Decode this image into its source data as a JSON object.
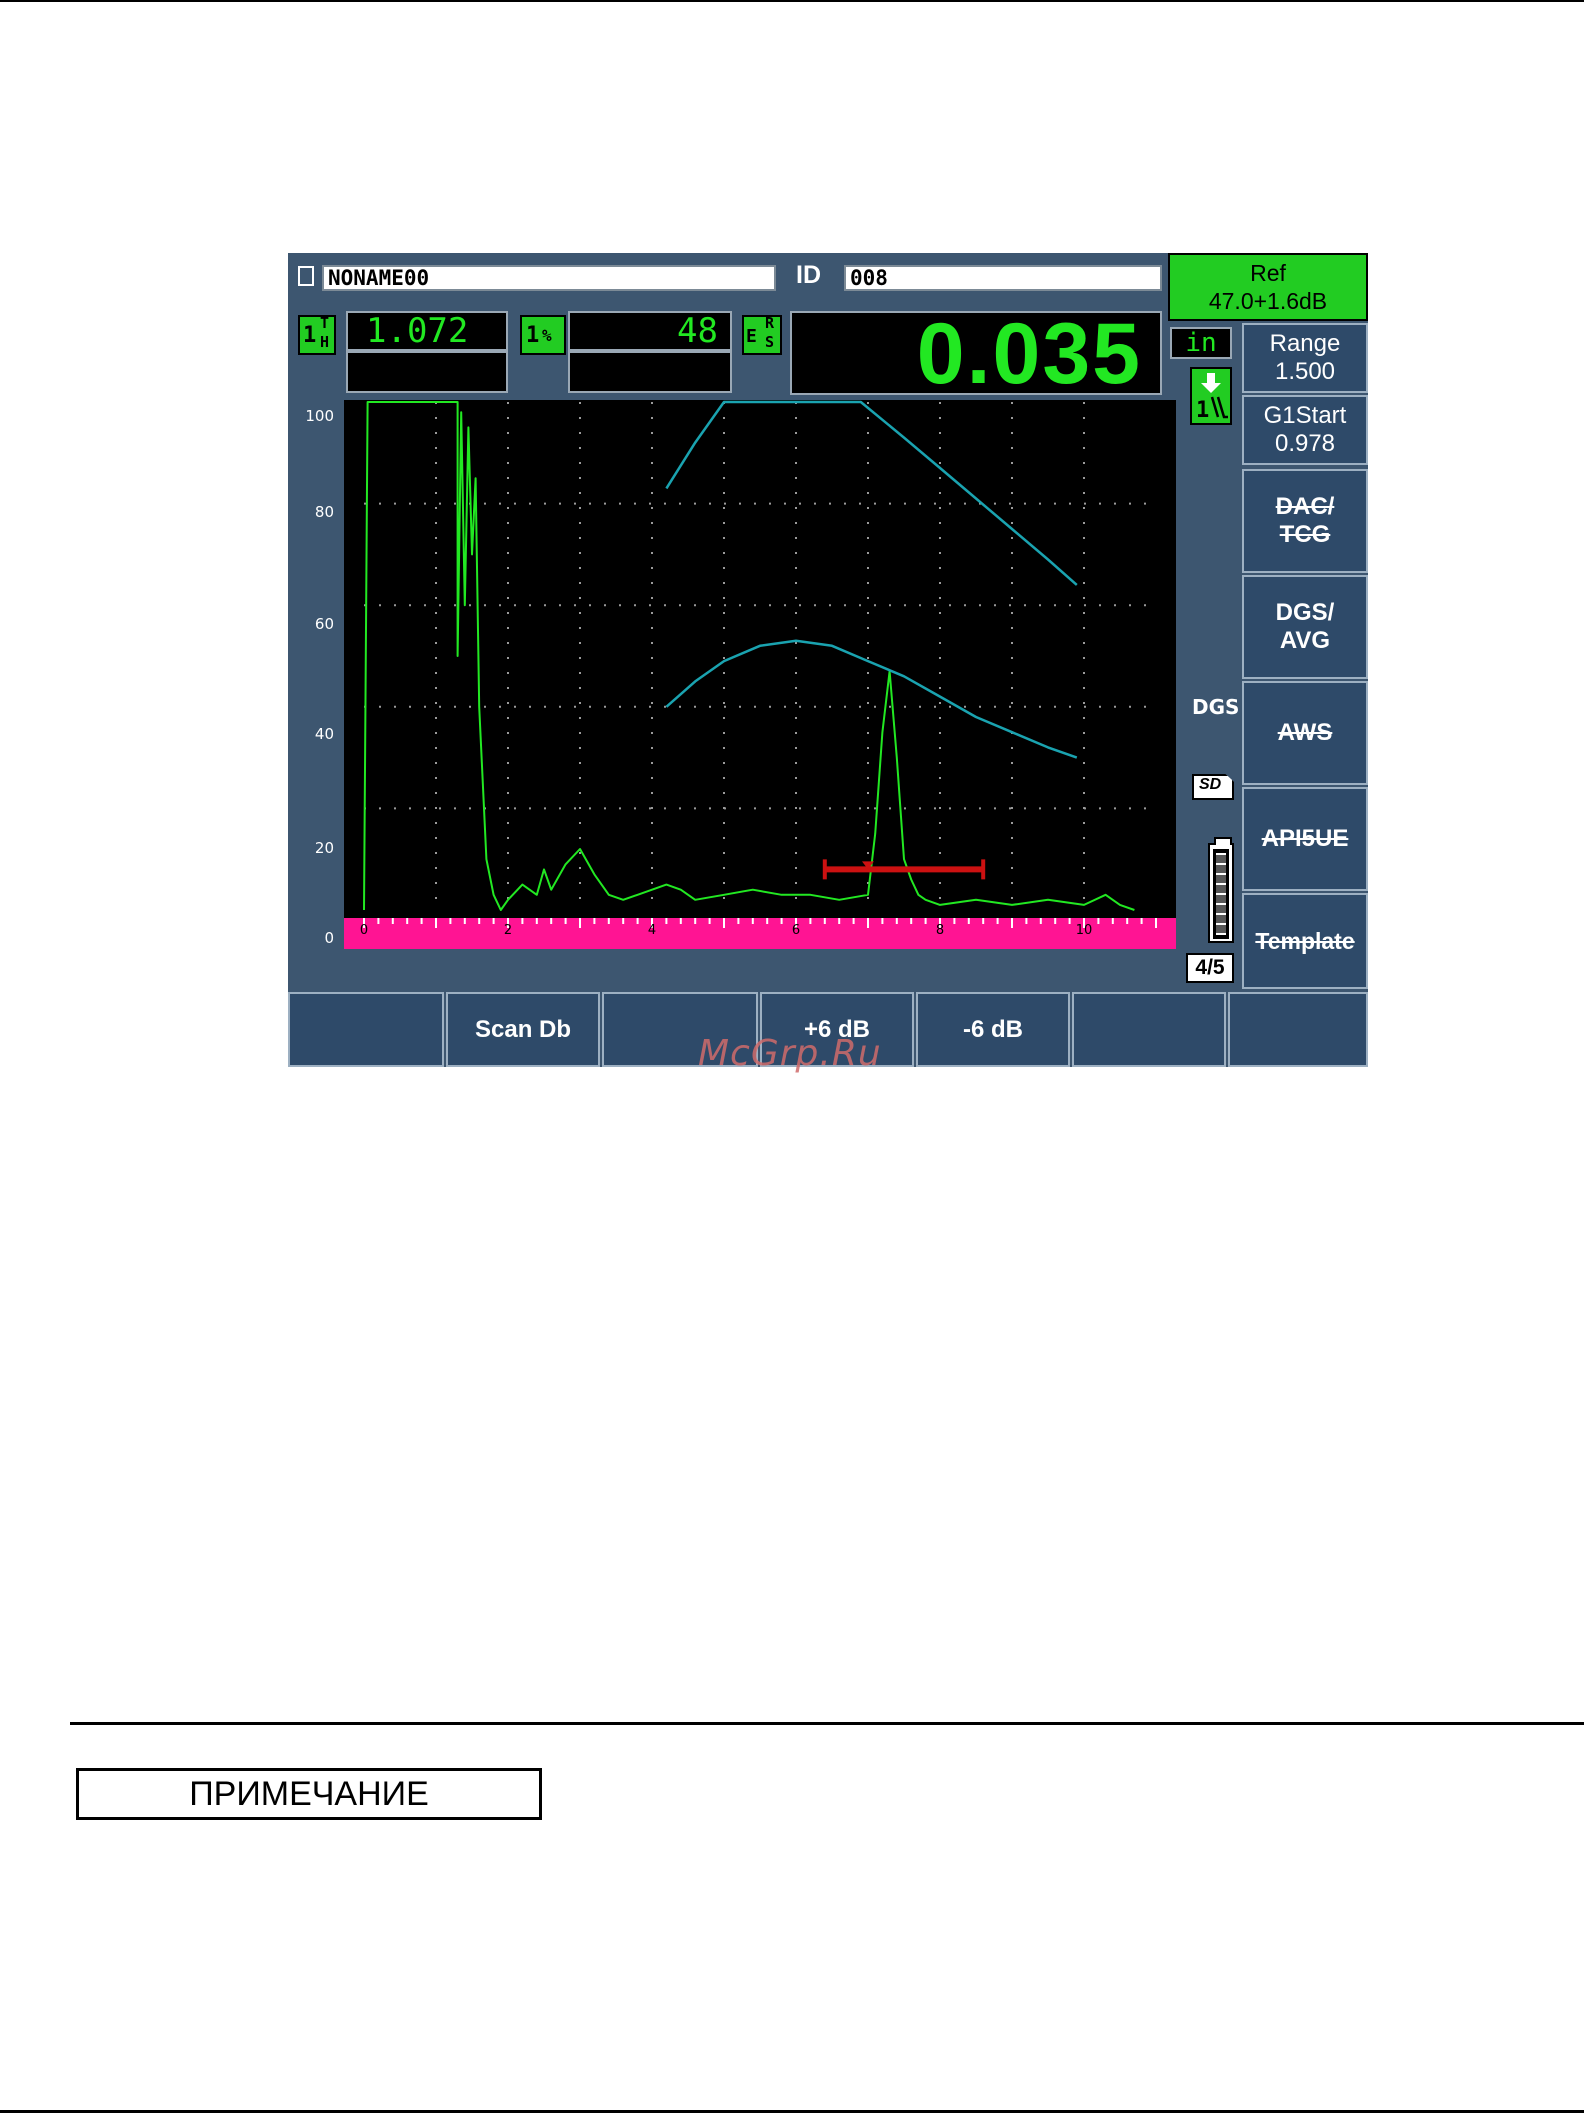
{
  "device": {
    "file_name": "NONAME00",
    "id_label": "ID",
    "id_value": "008",
    "ref": {
      "label": "Ref",
      "value": "47.0+1.6dB"
    },
    "readout_thickness": {
      "gate": "1",
      "sup": "T",
      "sub": "H",
      "value": "1.072"
    },
    "readout_amplitude": {
      "gate": "1",
      "unit": "%",
      "value": "48"
    },
    "readout_main": {
      "sup": "R",
      "sub": "S",
      "prefix": "E",
      "value": "0.035"
    },
    "unit": "in",
    "indicator_gate": "1",
    "dgs_label": "DGS",
    "sd_label": "SD",
    "page_indicator": "4/5",
    "side_buttons": {
      "range": {
        "label": "Range",
        "value": "1.500"
      },
      "g1start": {
        "label": "G1Start",
        "value": "0.978"
      },
      "dac_tcg": "DAC/ TCG",
      "dgs_avg": "DGS/ AVG",
      "aws": "AWS",
      "api5ue": "API5UE",
      "template": "Template"
    },
    "bottom_buttons": [
      "",
      "Scan Db",
      "",
      "+6 dB",
      "-6 dB",
      "",
      ""
    ],
    "colors": {
      "trace": "#22e822",
      "curves": "#1aa3b0",
      "gate": "#cc1111",
      "ruler": "#ff1493",
      "ref_bg": "#22cc22"
    }
  },
  "chart_data": {
    "type": "line",
    "y_ticks": [
      "100",
      "80",
      "60",
      "40",
      "20",
      "0"
    ],
    "x_ticks": [
      "0",
      "2",
      "4",
      "6",
      "8",
      "10"
    ],
    "xlim": [
      0,
      11
    ],
    "ylim": [
      0,
      100
    ],
    "series": [
      {
        "role": "a-scan",
        "x": [
          0,
          0.05,
          0.1,
          1.3,
          1.3,
          1.35,
          1.4,
          1.45,
          1.5,
          1.55,
          1.6,
          1.7,
          1.8,
          1.9,
          2.0,
          2.2,
          2.4,
          2.5,
          2.6,
          2.8,
          3.0,
          3.2,
          3.4,
          3.6,
          3.8,
          4.0,
          4.2,
          4.4,
          4.6,
          5.0,
          5.4,
          5.8,
          6.2,
          6.6,
          7.0,
          7.1,
          7.2,
          7.3,
          7.4,
          7.45,
          7.5,
          7.6,
          7.7,
          7.8,
          8.0,
          8.5,
          9.0,
          9.5,
          10.0,
          10.3,
          10.5,
          10.7
        ],
        "y": [
          0,
          100,
          100,
          100,
          50,
          98,
          60,
          95,
          70,
          85,
          40,
          10,
          3,
          0,
          2,
          5,
          3,
          8,
          4,
          9,
          12,
          7,
          3,
          2,
          3,
          4,
          5,
          4,
          2,
          3,
          4,
          3,
          3,
          2,
          3,
          15,
          35,
          47,
          30,
          20,
          10,
          6,
          3,
          2,
          1,
          2,
          1,
          2,
          1,
          3,
          1,
          0
        ]
      },
      {
        "role": "dgs-upper",
        "x": [
          4.2,
          4.6,
          5.0,
          6.0,
          6.9,
          7.5,
          8.0,
          8.5,
          9.0,
          9.5,
          9.9
        ],
        "y": [
          83,
          92,
          100,
          100,
          100,
          93,
          87,
          81,
          75,
          69,
          64
        ]
      },
      {
        "role": "dgs-lower",
        "x": [
          4.2,
          4.6,
          5.0,
          5.5,
          6.0,
          6.5,
          7.0,
          7.5,
          8.0,
          8.5,
          9.0,
          9.5,
          9.9
        ],
        "y": [
          40,
          45,
          49,
          52,
          53,
          52,
          49,
          46,
          42,
          38,
          35,
          32,
          30
        ]
      }
    ],
    "gate": {
      "start": 6.4,
      "end": 8.6,
      "level": 8
    }
  },
  "watermark": "McGrp.Ru",
  "note_label": "ПРИМЕЧАНИЕ"
}
